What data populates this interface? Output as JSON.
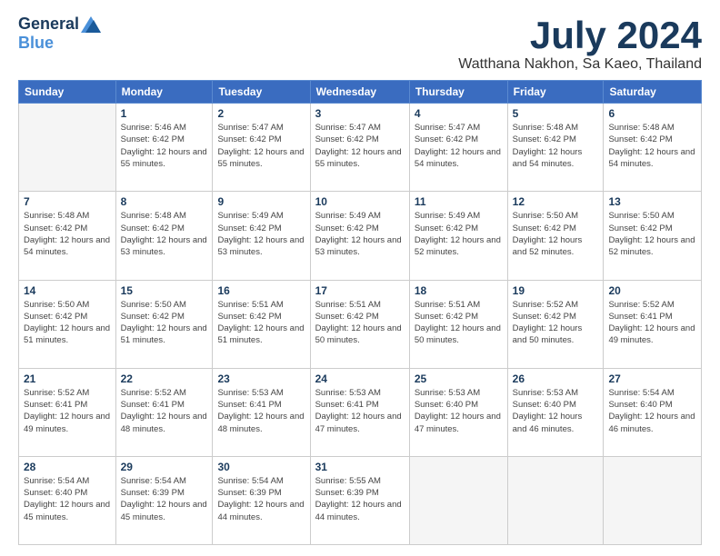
{
  "logo": {
    "general": "General",
    "blue": "Blue"
  },
  "header": {
    "month": "July 2024",
    "location": "Watthana Nakhon, Sa Kaeo, Thailand"
  },
  "weekdays": [
    "Sunday",
    "Monday",
    "Tuesday",
    "Wednesday",
    "Thursday",
    "Friday",
    "Saturday"
  ],
  "weeks": [
    [
      {
        "day": "",
        "info": ""
      },
      {
        "day": "1",
        "info": "Sunrise: 5:46 AM\nSunset: 6:42 PM\nDaylight: 12 hours\nand 55 minutes."
      },
      {
        "day": "2",
        "info": "Sunrise: 5:47 AM\nSunset: 6:42 PM\nDaylight: 12 hours\nand 55 minutes."
      },
      {
        "day": "3",
        "info": "Sunrise: 5:47 AM\nSunset: 6:42 PM\nDaylight: 12 hours\nand 55 minutes."
      },
      {
        "day": "4",
        "info": "Sunrise: 5:47 AM\nSunset: 6:42 PM\nDaylight: 12 hours\nand 54 minutes."
      },
      {
        "day": "5",
        "info": "Sunrise: 5:48 AM\nSunset: 6:42 PM\nDaylight: 12 hours\nand 54 minutes."
      },
      {
        "day": "6",
        "info": "Sunrise: 5:48 AM\nSunset: 6:42 PM\nDaylight: 12 hours\nand 54 minutes."
      }
    ],
    [
      {
        "day": "7",
        "info": ""
      },
      {
        "day": "8",
        "info": "Sunrise: 5:48 AM\nSunset: 6:42 PM\nDaylight: 12 hours\nand 53 minutes."
      },
      {
        "day": "9",
        "info": "Sunrise: 5:49 AM\nSunset: 6:42 PM\nDaylight: 12 hours\nand 53 minutes."
      },
      {
        "day": "10",
        "info": "Sunrise: 5:49 AM\nSunset: 6:42 PM\nDaylight: 12 hours\nand 53 minutes."
      },
      {
        "day": "11",
        "info": "Sunrise: 5:49 AM\nSunset: 6:42 PM\nDaylight: 12 hours\nand 52 minutes."
      },
      {
        "day": "12",
        "info": "Sunrise: 5:50 AM\nSunset: 6:42 PM\nDaylight: 12 hours\nand 52 minutes."
      },
      {
        "day": "13",
        "info": "Sunrise: 5:50 AM\nSunset: 6:42 PM\nDaylight: 12 hours\nand 52 minutes."
      }
    ],
    [
      {
        "day": "14",
        "info": ""
      },
      {
        "day": "15",
        "info": "Sunrise: 5:50 AM\nSunset: 6:42 PM\nDaylight: 12 hours\nand 51 minutes."
      },
      {
        "day": "16",
        "info": "Sunrise: 5:51 AM\nSunset: 6:42 PM\nDaylight: 12 hours\nand 51 minutes."
      },
      {
        "day": "17",
        "info": "Sunrise: 5:51 AM\nSunset: 6:42 PM\nDaylight: 12 hours\nand 50 minutes."
      },
      {
        "day": "18",
        "info": "Sunrise: 5:51 AM\nSunset: 6:42 PM\nDaylight: 12 hours\nand 50 minutes."
      },
      {
        "day": "19",
        "info": "Sunrise: 5:52 AM\nSunset: 6:42 PM\nDaylight: 12 hours\nand 50 minutes."
      },
      {
        "day": "20",
        "info": "Sunrise: 5:52 AM\nSunset: 6:41 PM\nDaylight: 12 hours\nand 49 minutes."
      }
    ],
    [
      {
        "day": "21",
        "info": ""
      },
      {
        "day": "22",
        "info": "Sunrise: 5:52 AM\nSunset: 6:41 PM\nDaylight: 12 hours\nand 48 minutes."
      },
      {
        "day": "23",
        "info": "Sunrise: 5:53 AM\nSunset: 6:41 PM\nDaylight: 12 hours\nand 48 minutes."
      },
      {
        "day": "24",
        "info": "Sunrise: 5:53 AM\nSunset: 6:41 PM\nDaylight: 12 hours\nand 47 minutes."
      },
      {
        "day": "25",
        "info": "Sunrise: 5:53 AM\nSunset: 6:40 PM\nDaylight: 12 hours\nand 47 minutes."
      },
      {
        "day": "26",
        "info": "Sunrise: 5:53 AM\nSunset: 6:40 PM\nDaylight: 12 hours\nand 46 minutes."
      },
      {
        "day": "27",
        "info": "Sunrise: 5:54 AM\nSunset: 6:40 PM\nDaylight: 12 hours\nand 46 minutes."
      }
    ],
    [
      {
        "day": "28",
        "info": "Sunrise: 5:54 AM\nSunset: 6:40 PM\nDaylight: 12 hours\nand 45 minutes."
      },
      {
        "day": "29",
        "info": "Sunrise: 5:54 AM\nSunset: 6:39 PM\nDaylight: 12 hours\nand 45 minutes."
      },
      {
        "day": "30",
        "info": "Sunrise: 5:54 AM\nSunset: 6:39 PM\nDaylight: 12 hours\nand 44 minutes."
      },
      {
        "day": "31",
        "info": "Sunrise: 5:55 AM\nSunset: 6:39 PM\nDaylight: 12 hours\nand 44 minutes."
      },
      {
        "day": "",
        "info": ""
      },
      {
        "day": "",
        "info": ""
      },
      {
        "day": "",
        "info": ""
      }
    ]
  ],
  "week7_sunday_info": "Sunrise: 5:48 AM\nSunset: 6:42 PM\nDaylight: 12 hours\nand 54 minutes.",
  "week14_sunday_info": "Sunrise: 5:50 AM\nSunset: 6:42 PM\nDaylight: 12 hours\nand 51 minutes.",
  "week21_sunday_info": "Sunrise: 5:52 AM\nSunset: 6:41 PM\nDaylight: 12 hours\nand 49 minutes."
}
